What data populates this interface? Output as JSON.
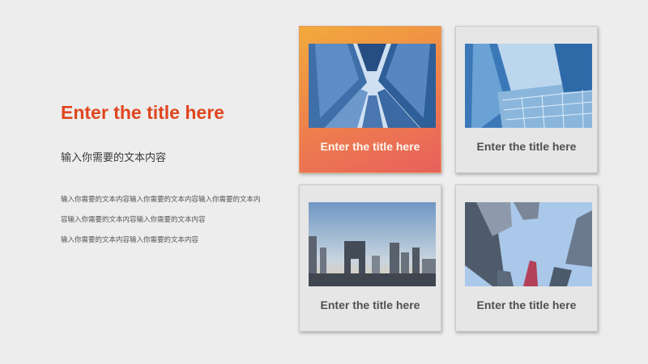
{
  "slide": {
    "title": "Enter the title here",
    "subtitle": "输入你需要的文本内容",
    "body_lines": [
      "输入你需要的文本内容输入你需要的文本内容输入你需要的文本内容输入你需要的文本内容输入你需要的文本内容",
      "输入你需要的文本内容输入你需要的文本内容"
    ],
    "cards": [
      {
        "caption": "Enter the title here",
        "highlighted": true,
        "photo": "skyscrapers-looking-up"
      },
      {
        "caption": "Enter the title here",
        "highlighted": false,
        "photo": "glass-building-facade"
      },
      {
        "caption": "Enter the title here",
        "highlighted": false,
        "photo": "city-skyline"
      },
      {
        "caption": "Enter the title here",
        "highlighted": false,
        "photo": "towers-looking-up"
      }
    ],
    "accent_color": "#e0461f",
    "highlight_gradient": [
      "#f2aa3c",
      "#e8605d"
    ]
  }
}
